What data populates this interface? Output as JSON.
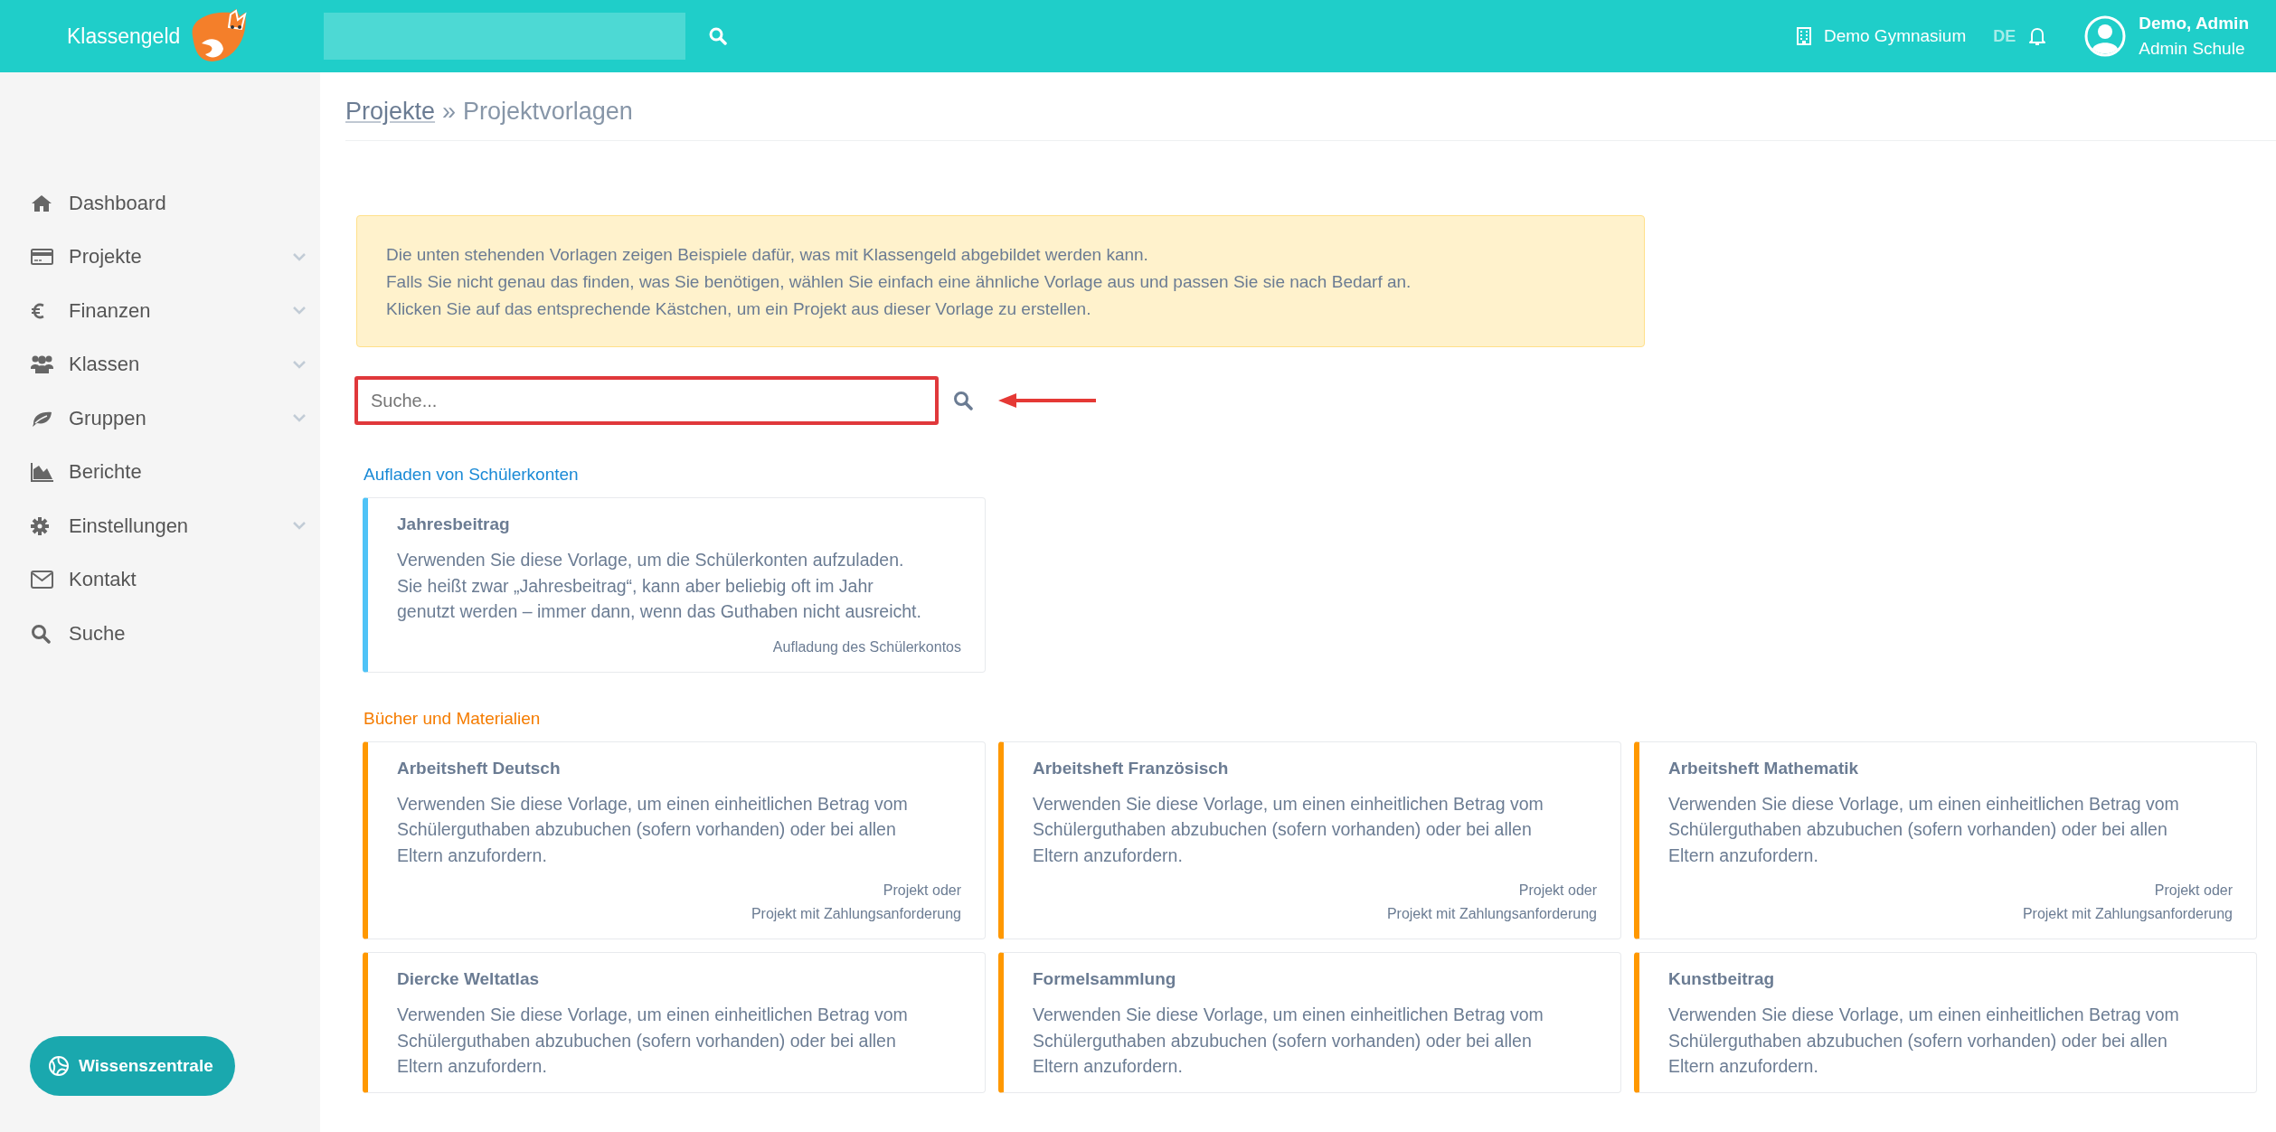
{
  "header": {
    "brand": "Klassengeld",
    "school": "Demo Gymnasium",
    "language": {
      "label": "DE",
      "selected": true
    },
    "user": {
      "name": "Demo, Admin",
      "role": "Admin Schule"
    }
  },
  "sidebar": {
    "items": [
      {
        "label": "Dashboard",
        "kind": "link"
      },
      {
        "label": "Projekte",
        "kind": "submenu"
      },
      {
        "label": "Finanzen",
        "kind": "submenu"
      },
      {
        "label": "Klassen",
        "kind": "submenu"
      },
      {
        "label": "Gruppen",
        "kind": "submenu"
      },
      {
        "label": "Berichte",
        "kind": "link"
      },
      {
        "label": "Einstellungen",
        "kind": "submenu"
      },
      {
        "label": "Kontakt",
        "kind": "link"
      },
      {
        "label": "Suche",
        "kind": "link"
      }
    ],
    "help_button": "Wissenszentrale"
  },
  "breadcrumb": {
    "parent": "Projekte",
    "separator": "»",
    "current": "Projektvorlagen"
  },
  "info_box": [
    "Die unten stehenden Vorlagen zeigen Beispiele dafür, was mit Klassengeld abgebildet werden kann.",
    "Falls Sie nicht genau das finden, was Sie benötigen, wählen Sie einfach eine ähnliche Vorlage aus und passen Sie sie nach Bedarf an.",
    "Klicken Sie auf das entsprechende Kästchen, um ein Projekt aus dieser Vorlage zu erstellen."
  ],
  "template_search": {
    "placeholder": "Suche...",
    "highlighted": true
  },
  "sections": [
    {
      "title": "Aufladen von Schülerkonten",
      "color": "#4fc3f7",
      "templates": [
        {
          "title": "Jahresbeitrag",
          "description": "Verwenden Sie diese Vorlage, um die Schülerkonten aufzuladen. Sie heißt zwar „Jahresbeitrag“, kann aber beliebig oft im Jahr genutzt werden – immer dann, wenn das Guthaben nicht ausreicht.",
          "footer": [
            "Aufladung des Schülerkontos"
          ]
        }
      ]
    },
    {
      "title": "Bücher und Materialien",
      "color": "#ff9800",
      "templates": [
        {
          "title": "Arbeitsheft Deutsch",
          "description": "Verwenden Sie diese Vorlage, um einen einheitlichen Betrag vom Schülerguthaben abzubuchen (sofern vorhanden) oder bei allen Eltern anzufordern.",
          "footer": [
            "Projekt oder",
            "Projekt mit Zahlungsanforderung"
          ]
        },
        {
          "title": "Arbeitsheft Französisch",
          "description": "Verwenden Sie diese Vorlage, um einen einheitlichen Betrag vom Schülerguthaben abzubuchen (sofern vorhanden) oder bei allen Eltern anzufordern.",
          "footer": [
            "Projekt oder",
            "Projekt mit Zahlungsanforderung"
          ]
        },
        {
          "title": "Arbeitsheft Mathematik",
          "description": "Verwenden Sie diese Vorlage, um einen einheitlichen Betrag vom Schülerguthaben abzubuchen (sofern vorhanden) oder bei allen Eltern anzufordern.",
          "footer": [
            "Projekt oder",
            "Projekt mit Zahlungsanforderung"
          ]
        },
        {
          "title": "Diercke Weltatlas",
          "description": "Verwenden Sie diese Vorlage, um einen einheitlichen Betrag vom Schülerguthaben abzubuchen (sofern vorhanden) oder bei allen Eltern anzufordern."
        },
        {
          "title": "Formelsammlung",
          "description": "Verwenden Sie diese Vorlage, um einen einheitlichen Betrag vom Schülerguthaben abzubuchen (sofern vorhanden) oder bei allen Eltern anzufordern."
        },
        {
          "title": "Kunstbeitrag",
          "description": "Verwenden Sie diese Vorlage, um einen einheitlichen Betrag vom Schülerguthaben abzubuchen (sofern vorhanden) oder bei allen Eltern anzufordern."
        }
      ]
    }
  ]
}
